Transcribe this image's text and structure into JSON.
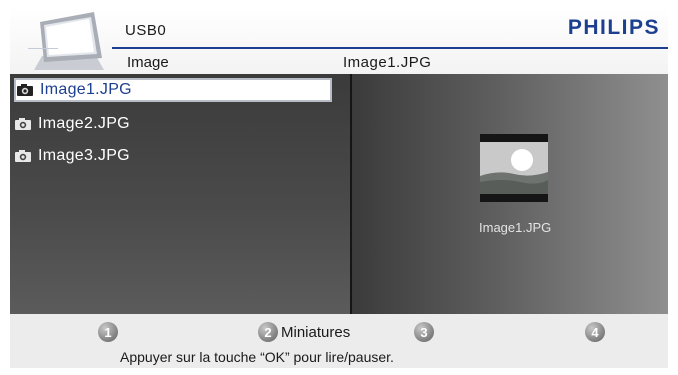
{
  "header": {
    "device": "USB0",
    "brand": "PHILIPS",
    "folder": "Image",
    "current_file": "Image1.JPG"
  },
  "file_list": [
    {
      "name": "Image1.JPG",
      "selected": true
    },
    {
      "name": "Image2.JPG",
      "selected": false
    },
    {
      "name": "Image3.JPG",
      "selected": false
    }
  ],
  "preview": {
    "filename": "Image1.JPG"
  },
  "footer": {
    "keys": [
      {
        "number": "1",
        "label": ""
      },
      {
        "number": "2",
        "label": "Miniatures"
      },
      {
        "number": "3",
        "label": ""
      },
      {
        "number": "4",
        "label": ""
      }
    ],
    "hint": "Appuyer sur la touche “OK” pour lire/pauser."
  },
  "colors": {
    "brand_blue": "#1d3f8f",
    "selected_text": "#1d3f8f"
  }
}
